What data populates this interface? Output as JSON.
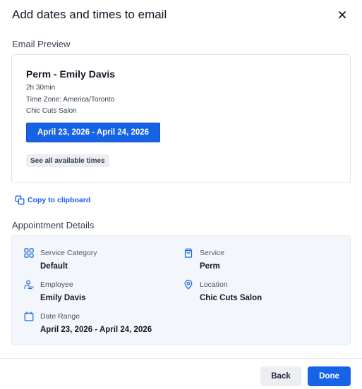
{
  "dialog": {
    "title": "Add dates and times to email",
    "close_icon": "close-icon"
  },
  "preview": {
    "section_label": "Email Preview",
    "title": "Perm - Emily Davis",
    "duration": "2h 30min",
    "timezone": "Time Zone: America/Toronto",
    "location": "Chic Cuts Salon",
    "date_button": "April 23, 2026 - April 24, 2026",
    "see_all": "See all available times"
  },
  "copy": {
    "label": "Copy to clipboard",
    "icon": "copy-icon"
  },
  "details": {
    "section_label": "Appointment Details",
    "service_category": {
      "label": "Service Category",
      "value": "Default",
      "icon": "grid-icon"
    },
    "service": {
      "label": "Service",
      "value": "Perm",
      "icon": "shopping-bag-icon"
    },
    "employee": {
      "label": "Employee",
      "value": "Emily Davis",
      "icon": "employee-icon"
    },
    "location": {
      "label": "Location",
      "value": "Chic Cuts Salon",
      "icon": "map-pin-icon"
    },
    "date_range": {
      "label": "Date Range",
      "value": "April 23, 2026 - April 24, 2026",
      "icon": "calendar-icon"
    }
  },
  "footer": {
    "back_label": "Back",
    "done_label": "Done"
  },
  "colors": {
    "primary": "#1763e5",
    "details_bg": "#f3f6fa",
    "border": "#dfe3e8"
  }
}
